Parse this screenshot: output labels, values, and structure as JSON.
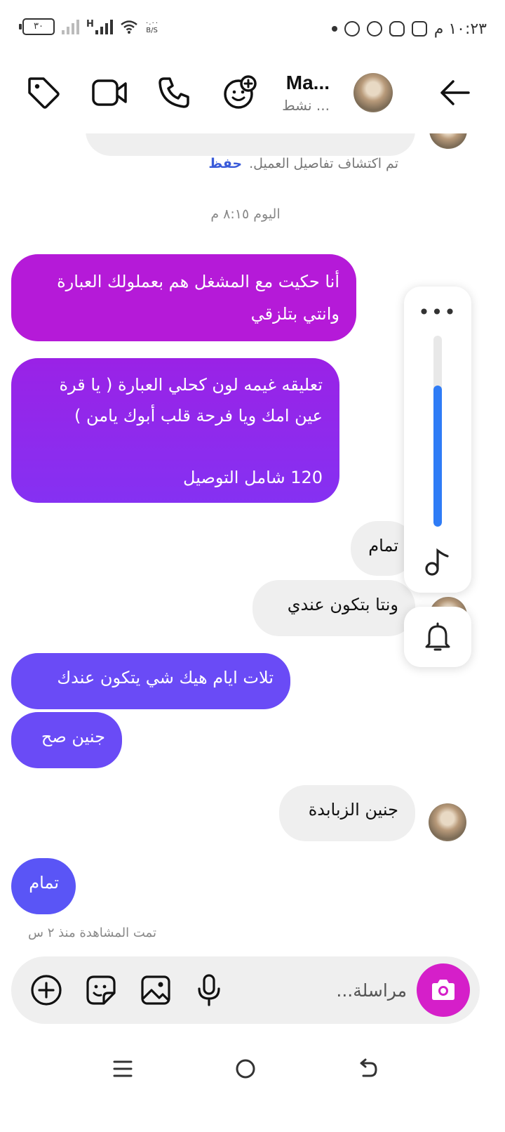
{
  "status_bar": {
    "time": "١٠:٢٣ م",
    "battery": "٣٠",
    "network_type": "H",
    "speed_value": "٠.٠٠",
    "speed_unit": "B/S"
  },
  "header": {
    "contact_name": "Ma...",
    "contact_status": "نشط ..."
  },
  "chat": {
    "detect_note": "تم اكتشاف تفاصيل العميل.",
    "detect_save": "حفظ",
    "date_separator": "اليوم ٨:١٥ م",
    "messages": [
      {
        "direction": "outgoing",
        "text": "أنا حكيت مع المشغل هم بعملولك العبارة\nوانتي بتلزقي",
        "color": "#b51ad8"
      },
      {
        "direction": "outgoing",
        "text": "تعليقه غيمه لون كحلي العبارة ( يا قرة\nعين امك ويا فرحة قلب أبوك يامن )\n\n120 شامل التوصيل",
        "color": "#8b2ef0"
      },
      {
        "direction": "incoming",
        "text": "تمام"
      },
      {
        "direction": "incoming",
        "text": "ونتا بتكون عندي"
      },
      {
        "direction": "outgoing",
        "text": "تلات ايام هيك شي يتكون عندك",
        "color": "#6a4bf6"
      },
      {
        "direction": "outgoing",
        "text": "جنين صح",
        "color": "#6a4bf6"
      },
      {
        "direction": "incoming",
        "text": "جنين الزبابدة"
      },
      {
        "direction": "outgoing",
        "text": "تمام",
        "color": "#5a55f6"
      }
    ],
    "seen_status": "تمت المشاهدة منذ ٢ س"
  },
  "volume_panel": {
    "more_label": "•••",
    "level": 0.74,
    "accent": "#2f7cf6"
  },
  "composer": {
    "placeholder": "مراسلة...",
    "camera_color": "#d51fc9",
    "icons": [
      "add-icon",
      "sticker-icon",
      "gallery-icon",
      "microphone-icon",
      "camera-icon"
    ]
  },
  "nav_bar": {
    "icons": [
      "menu-icon",
      "home-icon",
      "back-icon"
    ]
  }
}
